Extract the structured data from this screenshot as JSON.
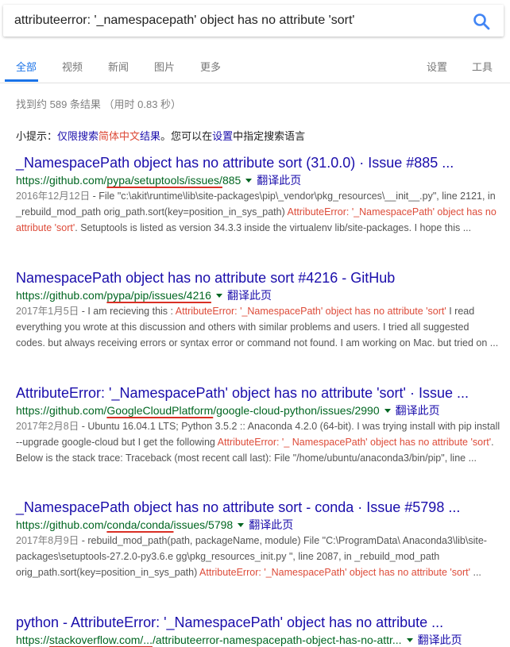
{
  "search": {
    "query": "attributeerror: '_namespacepath' object has no attribute 'sort'"
  },
  "tabs": [
    "全部",
    "视频",
    "新闻",
    "图片",
    "更多"
  ],
  "tools": [
    "设置",
    "工具"
  ],
  "stats": "找到约 589 条结果 （用时 0.83 秒）",
  "tip": {
    "prefix": "小提示：",
    "link_a": "仅限搜索",
    "lang": "简体中文",
    "link_b": "结果",
    "middle": "。您可以在",
    "settings": "设置",
    "suffix": "中指定搜索语言"
  },
  "translate_label": "翻译此页",
  "results": [
    {
      "title": "_NamespacePath object has no attribute sort (31.0.0) · Issue #885 ...",
      "url_a": "https://github.com/",
      "url_b": "pypa/setuptools/issues/",
      "url_c": "885",
      "date": "2016年12月12日",
      "s1": " - File \"c:\\akit\\runtime\\lib\\site-packages\\pip\\_vendor\\pkg_resources\\__init__.py\", line 2121, in _rebuild_mod_path orig_path.sort(key=position_in_sys_path) ",
      "hl1": "AttributeError: '_NamespacePath' object has no attribute 'sort'",
      "s2": ". Setuptools is listed as version 34.3.3 inside the virtualenv lib/site-packages. I hope this ..."
    },
    {
      "title": "NamespacePath object has no attribute sort #4216 - GitHub",
      "url_a": "https://github.com/",
      "url_b": "pypa/pip/issues/4216",
      "url_c": "",
      "date": "2017年1月5日",
      "s1": " - I am recieving this : ",
      "hl1": "AttributeError: '_NamespacePath' object has no attribute 'sort'",
      "s2": " I read everything you wrote at this discussion and others with similar problems and users. I tried all suggested codes. but always receiving errors or syntax error or command not found. I am working on Mac. but tried on ..."
    },
    {
      "title": "AttributeError: '_NamespacePath' object has no attribute 'sort' · Issue ...",
      "url_a": "https://github.com/",
      "url_b": "GoogleCloudPlatform",
      "url_c": "/google-cloud-python/issues/2990",
      "date": "2017年2月8日",
      "s1": " - Ubuntu 16.04.1 LTS; Python 3.5.2 :: Anaconda 4.2.0 (64-bit). I was trying install with pip install --upgrade google-cloud but I get the following ",
      "hl1": "AttributeError: '_ NamespacePath' object has no attribute 'sort'",
      "s2": ". Below is the stack trace: Traceback (most recent call last): File \"/home/ubuntu/anaconda3/bin/pip\", line ..."
    },
    {
      "title": "_NamespacePath object has no attribute sort - conda · Issue #5798 ...",
      "url_a": "https://github.com/",
      "url_b": "conda/conda/",
      "url_c": "issues/5798",
      "date": "2017年8月9日",
      "s1": " - rebuild_mod_path(path, packageName, module) File \"C:\\ProgramData\\ Anaconda3\\lib\\site-packages\\setuptools-27.2.0-py3.6.e gg\\pkg_resources_init.py \", line 2087, in _rebuild_mod_path orig_path.sort(key=position_in_sys_path) ",
      "hl1": "AttributeError: '_NamespacePath' object has no attribute 'sort'",
      "s2": " ..."
    },
    {
      "title": "python - AttributeError: '_NamespacePath' object has no attribute ...",
      "url_a": "https://",
      "url_b": "stackoverflow.com/...",
      "url_c": "/attributeerror-namespacepath-object-has-no-attr...",
      "date": "",
      "s1": "",
      "hl1": "",
      "s2": ""
    }
  ]
}
